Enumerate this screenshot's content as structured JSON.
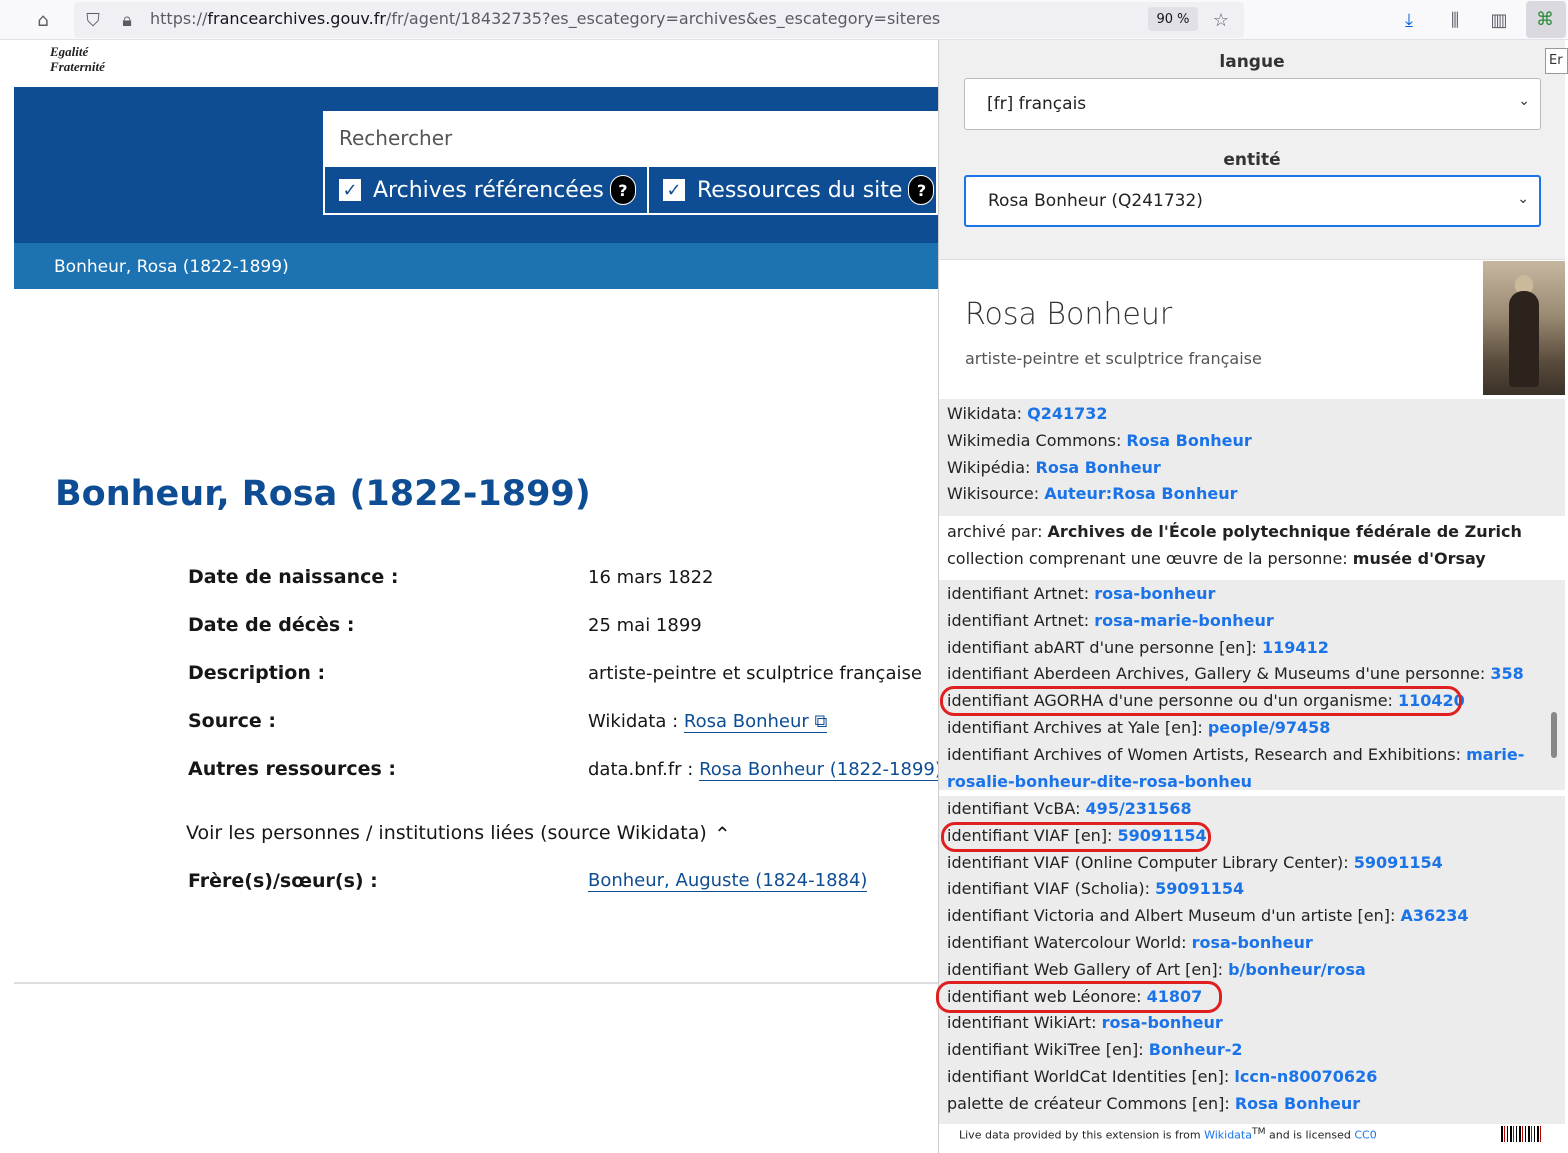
{
  "browser": {
    "url_prefix": "https://",
    "url_host": "francearchives.gouv.fr",
    "url_path": "/fr/agent/18432735?es_escategory=archives&es_escategory=siteres",
    "zoom": "90 %"
  },
  "site": {
    "logo_line1": "Egalité",
    "logo_line2": "Fraternité",
    "search_placeholder": "Rechercher",
    "filter1": "Archives référencées",
    "filter2": "Ressources du site",
    "help": "?",
    "breadcrumb": "Bonheur, Rosa (1822-1899)",
    "title": "Bonheur, Rosa (1822-1899)",
    "fields": [
      {
        "label": "Date de naissance :",
        "value": "16 mars 1822"
      },
      {
        "label": "Date de décès :",
        "value": "25 mai 1899"
      },
      {
        "label": "Description :",
        "value": "artiste-peintre et sculptrice française"
      },
      {
        "label": "Source :",
        "prefix": "Wikidata : ",
        "link": "Rosa Bonheur"
      },
      {
        "label": "Autres ressources :",
        "prefix": "data.bnf.fr : ",
        "link": "Rosa Bonheur (1822-1899)"
      }
    ],
    "related_toggle": "Voir les personnes / institutions liées (source Wikidata)",
    "sibling_label": "Frère(s)/sœur(s) :",
    "sibling_link": "Bonheur, Auguste (1824-1884)"
  },
  "popup": {
    "language_label": "langue",
    "language_value": "[fr] français",
    "entity_label": "entité",
    "entity_value": "Rosa Bonheur (Q241732)",
    "entity_name": "Rosa Bonheur",
    "entity_description": "artiste-peintre et sculptrice française",
    "links": [
      {
        "k": "Wikidata: ",
        "v": "Q241732"
      },
      {
        "k": "Wikimedia Commons: ",
        "v": "Rosa Bonheur"
      },
      {
        "k": "Wikipédia: ",
        "v": "Rosa Bonheur"
      },
      {
        "k": "Wikisource: ",
        "v": "Auteur:Rosa Bonheur"
      }
    ],
    "relations": [
      {
        "k": "archivé par: ",
        "v": "Archives de l'École polytechnique fédérale de Zurich"
      },
      {
        "k": "collection comprenant une œuvre de la personne: ",
        "v": "musée d'Orsay"
      }
    ],
    "identifiers_1": [
      {
        "k": "identifiant Artnet: ",
        "v": "rosa-bonheur"
      },
      {
        "k": "identifiant Artnet: ",
        "v": "rosa-marie-bonheur"
      },
      {
        "k": "identifiant abART d'une personne [en]: ",
        "v": "119412"
      },
      {
        "k": "identifiant Aberdeen Archives, Gallery & Museums d'une personne: ",
        "v": "358"
      },
      {
        "k": "identifiant AGORHA d'une personne ou d'un organisme: ",
        "v": "110420"
      },
      {
        "k": "identifiant Archives at Yale [en]: ",
        "v": "people/97458"
      },
      {
        "k": "identifiant Archives of Women Artists, Research and Exhibitions: ",
        "v": "marie-rosalie-bonheur-dite-rosa-bonheu"
      }
    ],
    "identifiers_2": [
      {
        "k": "identifiant VcBA: ",
        "v": "495/231568"
      },
      {
        "k": "identifiant VIAF [en]: ",
        "v": "59091154"
      },
      {
        "k": "identifiant VIAF (Online Computer Library Center): ",
        "v": "59091154"
      },
      {
        "k": "identifiant VIAF (Scholia): ",
        "v": "59091154"
      },
      {
        "k": "identifiant Victoria and Albert Museum d'un artiste [en]: ",
        "v": "A36234"
      },
      {
        "k": "identifiant Watercolour World: ",
        "v": "rosa-bonheur"
      },
      {
        "k": "identifiant Web Gallery of Art [en]: ",
        "v": "b/bonheur/rosa"
      },
      {
        "k": "identifiant web Léonore: ",
        "v": "41807"
      },
      {
        "k": "identifiant WikiArt: ",
        "v": "rosa-bonheur"
      },
      {
        "k": "identifiant WikiTree [en]: ",
        "v": "Bonheur-2"
      },
      {
        "k": "identifiant WorldCat Identities [en]: ",
        "v": "lccn-n80070626"
      },
      {
        "k": "palette de créateur Commons [en]: ",
        "v": "Rosa Bonheur"
      }
    ],
    "footer_pre": "Live data provided by this extension is from ",
    "footer_wikidata": "Wikidata",
    "footer_tm": "TM",
    "footer_mid": " and is licensed ",
    "footer_cc0": "CC0",
    "corner_text": "Er"
  },
  "colors": {
    "site_blue": "#0e4d94",
    "breadcrumb_blue": "#1d73b2",
    "link_blue": "#1a73e8",
    "highlight_red": "#e02020"
  }
}
